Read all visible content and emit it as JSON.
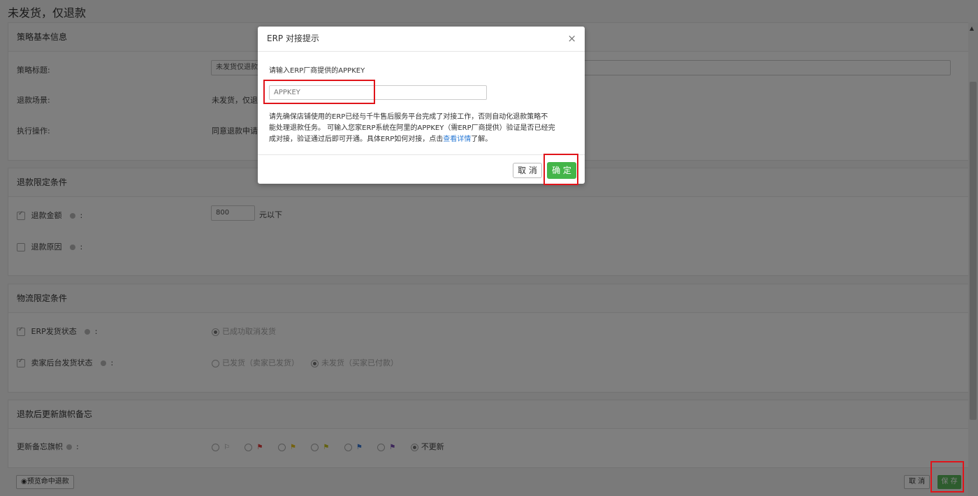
{
  "page_title": "未发货，仅退款",
  "basic_info": {
    "header": "策略基本信息",
    "title_label": "策略标题:",
    "title_value": "未发货仅退款",
    "scene_label": "退款场景:",
    "scene_value": "未发货，仅退",
    "action_label": "执行操作:",
    "action_value": "同意退款申请"
  },
  "refund_conditions": {
    "header": "退款限定条件",
    "amount_label": "退款金额",
    "amount_value": "800",
    "amount_suffix": "元以下",
    "reason_label": "退款原因",
    "colon": ":"
  },
  "logistics_conditions": {
    "header": "物流限定条件",
    "erp_label": "ERP发货状态",
    "erp_option": "已成功取消发货",
    "seller_label": "卖家后台发货状态",
    "seller_option_shipped": "已发货（卖家已发货）",
    "seller_option_unshipped": "未发货（买家已付款）"
  },
  "flag_memo": {
    "header": "退款后更新旗帜备忘",
    "label": "更新备忘旗帜",
    "no_update": "不更新",
    "flag_colors": [
      "#999999",
      "#e23c3c",
      "#e8c51f",
      "#c8c520",
      "#3a7bd5",
      "#7a4fb5"
    ]
  },
  "footer": {
    "preview_label": "预览命中退款",
    "cancel_label": "取 消",
    "save_label": "保 存"
  },
  "modal": {
    "title": "ERP 对接提示",
    "close": "×",
    "prompt": "请输入ERP厂商提供的APPKEY",
    "input_placeholder": "APPKEY",
    "note_line1": "请先确保店铺使用的ERP已经与千牛售后服务平台完成了对接工作，否则自动化退款策略不",
    "note_line2": "能处理退款任务。 可输入您家ERP系统在阿里的APPKEY（需ERP厂商提供）验证是否已经完",
    "note_line3_prefix": "成对接，验证通过后即可开通。具体ERP如何对接，点击",
    "note_link": "查看详情",
    "note_line3_suffix": "了解。",
    "cancel_label": "取 消",
    "ok_label": "确 定"
  },
  "colors": {
    "primary_green": "#44b549",
    "link_blue": "#2a7ad5",
    "highlight_red": "#e0141a"
  }
}
